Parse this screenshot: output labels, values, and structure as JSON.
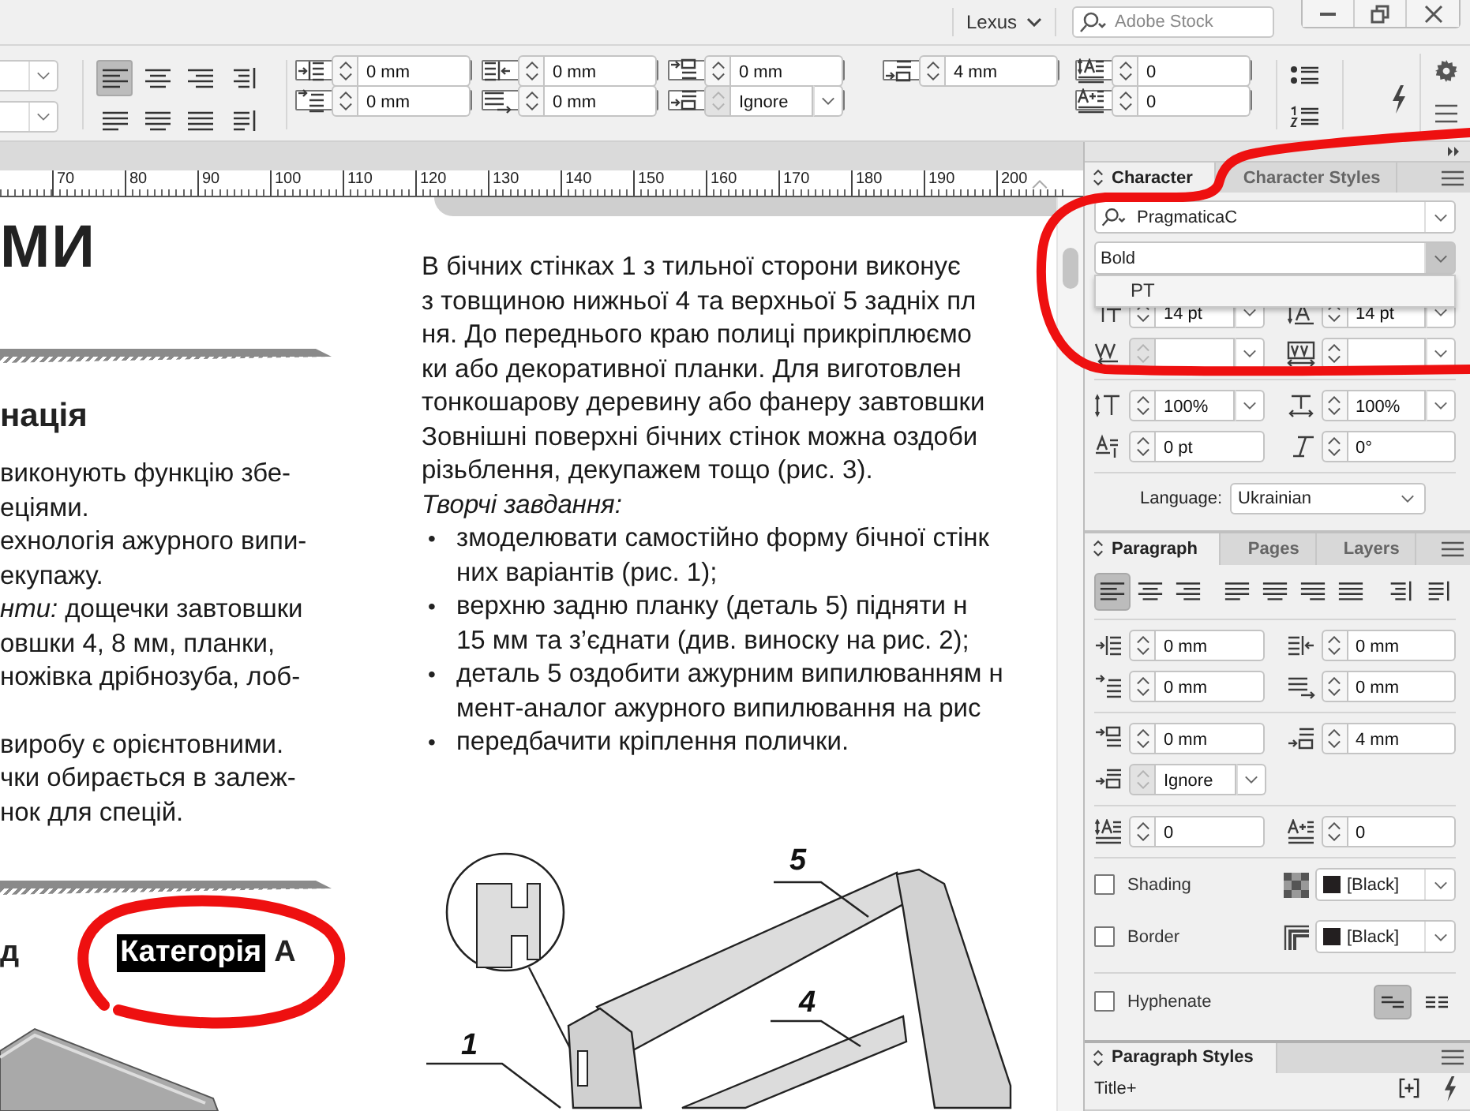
{
  "top_bar": {
    "user": "Lexus",
    "search": {
      "placeholder": "Adobe Stock"
    }
  },
  "control_bar": {
    "align_buttons": [
      {
        "kind": "left",
        "selected": true
      },
      {
        "kind": "center",
        "selected": false
      },
      {
        "kind": "right",
        "selected": false
      },
      {
        "kind": "spine",
        "selected": false
      },
      {
        "kind": "justify-left",
        "selected": false
      },
      {
        "kind": "justify-center",
        "selected": false
      },
      {
        "kind": "justify-all",
        "selected": false
      },
      {
        "kind": "away-spine",
        "selected": false
      }
    ],
    "field_columns": [
      [
        {
          "kind": "left-indent",
          "value": "0 mm",
          "dropdown": false,
          "disabled": false
        },
        {
          "kind": "first-line-indent",
          "value": "0 mm",
          "dropdown": false,
          "disabled": false
        }
      ],
      [
        {
          "kind": "right-indent",
          "value": "0 mm",
          "dropdown": false,
          "disabled": false
        },
        {
          "kind": "last-line-indent",
          "value": "0 mm",
          "dropdown": false,
          "disabled": false
        }
      ],
      [
        {
          "kind": "space-before",
          "value": "0 mm",
          "dropdown": false,
          "disabled": false
        },
        {
          "kind": "grid-align",
          "value": "Ignore",
          "dropdown": true,
          "disabled": true
        }
      ],
      [
        {
          "kind": "space-after",
          "value": "4 mm",
          "dropdown": false,
          "disabled": false
        }
      ],
      [
        {
          "kind": "drop-cap-lines",
          "value": "0",
          "dropdown": false,
          "disabled": false
        },
        {
          "kind": "drop-cap-chars",
          "value": "0",
          "dropdown": false,
          "disabled": false
        }
      ]
    ]
  },
  "ruler": {
    "labels": [
      "70",
      "80",
      "90",
      "100",
      "110",
      "120",
      "130",
      "140",
      "150",
      "160",
      "170",
      "180",
      "190",
      "200"
    ]
  },
  "document": {
    "left_column": {
      "heading": "МИ",
      "subheading": "нація",
      "lines": [
        "виконують функцію збе-",
        "еціями.",
        "ехнологія ажурного випи-",
        "екупажу.",
        "*нти:* дощечки завтовшки",
        "овшки 4, 8 мм, планки,",
        "ножівка дрібнозуба, лоб-"
      ],
      "lines_2": [
        "виробу є орієнтовними.",
        "чки обирається в залеж-",
        "нок для спецій."
      ],
      "heading_3": "д",
      "category": [
        {
          "text": "Категорія",
          "selected": true
        },
        {
          "text": "А",
          "selected": false
        }
      ]
    },
    "right_column": {
      "lines": [
        "В бічних стінках 1 з тильної сторони виконує",
        "з товщиною нижньої 4 та верхньої 5 задніх пл",
        "ня. До переднього краю полиці прикріплюємо",
        "ки або декоративної планки. Для виготовлен",
        "тонкошарову деревину або фанеру завтовшки",
        "Зовнішні поверхні бічних стінок можна оздоби",
        "різьблення, декупажем тощо (рис. 3)."
      ],
      "task_heading": "Творчі завдання:",
      "bullets": [
        {
          "marker": "•",
          "lines": [
            "змоделювати самостійно форму бічної стінк",
            "них варіантів (рис. 1);"
          ]
        },
        {
          "marker": "•",
          "lines": [
            "верхню задню планку (деталь 5) підняти н",
            "15 мм та з’єднати (див. виноску на рис. 2);"
          ]
        },
        {
          "marker": "•",
          "lines": [
            "деталь 5 оздобити ажурним випилюванням н",
            "мент-аналог ажурного випилювання на рис"
          ]
        },
        {
          "marker": "•",
          "lines": [
            "передбачити кріплення полички."
          ]
        }
      ]
    },
    "figure": {
      "callouts": [
        "5",
        "4",
        "1"
      ]
    }
  },
  "character_panel": {
    "tabs": [
      {
        "label": "Character",
        "selected": true
      },
      {
        "label": "Character Styles",
        "selected": false
      }
    ],
    "font": "PragmaticaC",
    "style": "Bold",
    "style_menu": {
      "open": true,
      "options": [
        "PT"
      ]
    },
    "field_rows": [
      [
        {
          "kind": "font-size",
          "value": "14 pt",
          "dropdown": true,
          "disabled": false
        },
        {
          "kind": "leading",
          "value": "14 pt",
          "dropdown": true,
          "disabled": false
        }
      ],
      [
        {
          "kind": "kerning",
          "dropdown": true,
          "disabled": true
        },
        {
          "kind": "tracking",
          "dropdown": true,
          "disabled": false
        }
      ]
    ],
    "field_rows_2": [
      [
        {
          "kind": "vertical-scale",
          "value": "100%",
          "dropdown": true,
          "disabled": false
        },
        {
          "kind": "horizontal-scale",
          "value": "100%",
          "dropdown": true,
          "disabled": false
        }
      ],
      [
        {
          "kind": "baseline-shift",
          "value": "0 pt",
          "dropdown": false,
          "disabled": false
        },
        {
          "kind": "skew",
          "value": "0°",
          "dropdown": false,
          "disabled": false
        }
      ]
    ],
    "language": {
      "label": "Language:",
      "value": "Ukrainian"
    }
  },
  "paragraph_panel": {
    "tabs": [
      {
        "label": "Paragraph",
        "selected": true
      },
      {
        "label": "Pages",
        "selected": false
      },
      {
        "label": "Layers",
        "selected": false
      }
    ],
    "align_buttons": [
      {
        "kind": "left",
        "selected": true
      },
      {
        "kind": "center",
        "selected": false
      },
      {
        "kind": "right",
        "selected": false
      },
      {
        "kind": "justify-left",
        "selected": false
      },
      {
        "kind": "justify-center",
        "selected": false
      },
      {
        "kind": "justify-right",
        "selected": false
      },
      {
        "kind": "justify-all",
        "selected": false
      },
      {
        "kind": "spine",
        "selected": false
      },
      {
        "kind": "away-spine",
        "selected": false
      }
    ],
    "field_sections": [
      [
        [
          {
            "kind": "left-indent",
            "value": "0 mm",
            "dropdown": false,
            "disabled": false
          },
          {
            "kind": "right-indent",
            "value": "0 mm",
            "dropdown": false,
            "disabled": false
          }
        ],
        [
          {
            "kind": "first-line-indent",
            "value": "0 mm",
            "dropdown": false,
            "disabled": false
          },
          {
            "kind": "last-line-indent",
            "value": "0 mm",
            "dropdown": false,
            "disabled": false
          }
        ]
      ],
      [
        [
          {
            "kind": "space-before",
            "value": "0 mm",
            "dropdown": false,
            "disabled": false
          },
          {
            "kind": "space-after",
            "value": "4 mm",
            "dropdown": false,
            "disabled": false
          }
        ],
        [
          {
            "kind": "grid-align",
            "value": "Ignore",
            "dropdown": true,
            "disabled": true
          }
        ]
      ],
      [
        [
          {
            "kind": "drop-cap-lines",
            "value": "0",
            "dropdown": false,
            "disabled": false
          },
          {
            "kind": "drop-cap-chars",
            "value": "0",
            "dropdown": false,
            "disabled": false
          }
        ]
      ]
    ],
    "options": [
      {
        "kind": "shading",
        "label": "Shading",
        "checked": false,
        "swatch": "[Black]"
      },
      {
        "kind": "border",
        "label": "Border",
        "checked": false,
        "swatch": "[Black]"
      },
      {
        "kind": "hyphenate",
        "label": "Hyphenate",
        "checked": false
      }
    ],
    "composer_buttons": [
      {
        "kind": "single-line",
        "selected": true
      },
      {
        "kind": "multi-line",
        "selected": false
      }
    ]
  },
  "paragraph_styles": {
    "tabs": [
      {
        "label": "Paragraph Styles",
        "selected": true
      }
    ],
    "current": "Title+"
  }
}
